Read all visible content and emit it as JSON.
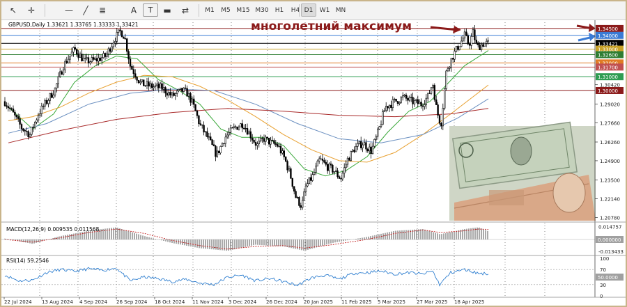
{
  "toolbar": {
    "tools": [
      {
        "name": "cursor-icon",
        "glyph": "↖"
      },
      {
        "name": "crosshair-icon",
        "glyph": "✛"
      },
      {
        "name": "horizontal-line-icon",
        "glyph": "—"
      },
      {
        "name": "trend-line-icon",
        "glyph": "╱"
      },
      {
        "name": "fibonacci-icon",
        "glyph": "≣"
      },
      {
        "name": "text-tool-icon",
        "glyph": "A"
      },
      {
        "name": "text-label-icon",
        "glyph": "T"
      },
      {
        "name": "rectangle-icon",
        "glyph": "▬"
      },
      {
        "name": "shapes-menu-icon",
        "glyph": "⇄"
      }
    ],
    "timeframes": [
      "M1",
      "M5",
      "M15",
      "M30",
      "H1",
      "H4",
      "D1",
      "W1",
      "MN"
    ],
    "active_timeframe": "D1"
  },
  "chart_data": {
    "type": "candlestick",
    "symbol_info": "GBPUSD,Daily  1.33621  1.33765  1.33333  1.33421",
    "annotation": "многолетний максимум",
    "ylim": [
      1.2045,
      1.3495
    ],
    "price_ticks": [
      "1.34500",
      "1.34000",
      "1.33421",
      "1.33000",
      "1.32600",
      "1.32000",
      "1.31700",
      "1.31000",
      "1.30420",
      "1.30000",
      "1.29020",
      "1.27660",
      "1.26260",
      "1.24900",
      "1.23500",
      "1.22140",
      "1.20780"
    ],
    "price_levels": [
      {
        "value": 1.345,
        "label": "1.34500",
        "color": "#8b1a1a"
      },
      {
        "value": 1.34,
        "label": "1.34000",
        "color": "#3a7bd5"
      },
      {
        "value": 1.33421,
        "label": "1.33421",
        "color": "#000000"
      },
      {
        "value": 1.33,
        "label": "1.33000",
        "color": "#c9a227"
      },
      {
        "value": 1.326,
        "label": "1.32600",
        "color": "#2e7d32"
      },
      {
        "value": 1.32,
        "label": "1.32000",
        "color": "#e07b24"
      },
      {
        "value": 1.317,
        "label": "1.31700",
        "color": "#c05050"
      },
      {
        "value": 1.31,
        "label": "1.31000",
        "color": "#2e9d52"
      },
      {
        "value": 1.3,
        "label": "1.30000",
        "color": "#8b1a1a"
      }
    ],
    "date_labels": [
      "22 Jul 2024",
      "13 Aug 2024",
      "4 Sep 2024",
      "26 Sep 2024",
      "18 Oct 2024",
      "11 Nov 2024",
      "3 Dec 2024",
      "26 Dec 2024",
      "20 Jan 2025",
      "11 Feb 2025",
      "5 Mar 2025",
      "27 Mar 2025",
      "18 Apr 2025"
    ],
    "anchors": [
      [
        0,
        1.292
      ],
      [
        12,
        1.283
      ],
      [
        24,
        1.273
      ],
      [
        36,
        1.268
      ],
      [
        48,
        1.283
      ],
      [
        60,
        1.292
      ],
      [
        72,
        1.301
      ],
      [
        84,
        1.318
      ],
      [
        100,
        1.33
      ],
      [
        115,
        1.321
      ],
      [
        130,
        1.322
      ],
      [
        145,
        1.325
      ],
      [
        158,
        1.338
      ],
      [
        166,
        1.343
      ],
      [
        172,
        1.339
      ],
      [
        180,
        1.318
      ],
      [
        195,
        1.305
      ],
      [
        210,
        1.303
      ],
      [
        225,
        1.302
      ],
      [
        240,
        1.296
      ],
      [
        255,
        1.3
      ],
      [
        262,
        1.298
      ],
      [
        270,
        1.29
      ],
      [
        280,
        1.275
      ],
      [
        292,
        1.265
      ],
      [
        304,
        1.253
      ],
      [
        316,
        1.266
      ],
      [
        330,
        1.273
      ],
      [
        342,
        1.276
      ],
      [
        352,
        1.268
      ],
      [
        362,
        1.26
      ],
      [
        372,
        1.265
      ],
      [
        382,
        1.262
      ],
      [
        392,
        1.26
      ],
      [
        402,
        1.25
      ],
      [
        410,
        1.238
      ],
      [
        418,
        1.222
      ],
      [
        426,
        1.216
      ],
      [
        432,
        1.23
      ],
      [
        442,
        1.238
      ],
      [
        452,
        1.25
      ],
      [
        462,
        1.245
      ],
      [
        472,
        1.242
      ],
      [
        482,
        1.236
      ],
      [
        492,
        1.25
      ],
      [
        502,
        1.258
      ],
      [
        514,
        1.262
      ],
      [
        526,
        1.256
      ],
      [
        536,
        1.27
      ],
      [
        546,
        1.288
      ],
      [
        560,
        1.292
      ],
      [
        572,
        1.295
      ],
      [
        584,
        1.292
      ],
      [
        598,
        1.29
      ],
      [
        608,
        1.296
      ],
      [
        614,
        1.306
      ],
      [
        620,
        1.285
      ],
      [
        626,
        1.275
      ],
      [
        634,
        1.315
      ],
      [
        644,
        1.326
      ],
      [
        652,
        1.333
      ],
      [
        660,
        1.34
      ],
      [
        666,
        1.333
      ],
      [
        672,
        1.342
      ],
      [
        678,
        1.331
      ],
      [
        686,
        1.334
      ],
      [
        694,
        1.3342
      ]
    ],
    "moving_averages": [
      {
        "color": "#3aa83a",
        "points": [
          [
            5,
            1.288
          ],
          [
            40,
            1.272
          ],
          [
            70,
            1.283
          ],
          [
            100,
            1.306
          ],
          [
            130,
            1.318
          ],
          [
            160,
            1.325
          ],
          [
            190,
            1.323
          ],
          [
            220,
            1.308
          ],
          [
            250,
            1.3
          ],
          [
            280,
            1.29
          ],
          [
            310,
            1.272
          ],
          [
            340,
            1.266
          ],
          [
            370,
            1.266
          ],
          [
            400,
            1.26
          ],
          [
            430,
            1.243
          ],
          [
            460,
            1.238
          ],
          [
            490,
            1.242
          ],
          [
            520,
            1.252
          ],
          [
            550,
            1.27
          ],
          [
            580,
            1.285
          ],
          [
            610,
            1.292
          ],
          [
            630,
            1.302
          ],
          [
            660,
            1.318
          ],
          [
            694,
            1.329
          ]
        ]
      },
      {
        "color": "#e8a030",
        "points": [
          [
            5,
            1.278
          ],
          [
            40,
            1.281
          ],
          [
            80,
            1.288
          ],
          [
            120,
            1.298
          ],
          [
            160,
            1.306
          ],
          [
            200,
            1.311
          ],
          [
            240,
            1.31
          ],
          [
            280,
            1.303
          ],
          [
            320,
            1.293
          ],
          [
            360,
            1.281
          ],
          [
            400,
            1.268
          ],
          [
            440,
            1.257
          ],
          [
            480,
            1.249
          ],
          [
            520,
            1.248
          ],
          [
            560,
            1.255
          ],
          [
            600,
            1.268
          ],
          [
            640,
            1.283
          ],
          [
            694,
            1.304
          ]
        ]
      },
      {
        "color": "#6a8fc0",
        "points": [
          [
            5,
            1.269
          ],
          [
            60,
            1.276
          ],
          [
            120,
            1.29
          ],
          [
            180,
            1.298
          ],
          [
            240,
            1.301
          ],
          [
            300,
            1.3
          ],
          [
            360,
            1.29
          ],
          [
            420,
            1.276
          ],
          [
            480,
            1.265
          ],
          [
            540,
            1.262
          ],
          [
            600,
            1.268
          ],
          [
            650,
            1.28
          ],
          [
            694,
            1.294
          ]
        ]
      },
      {
        "color": "#a82828",
        "points": [
          [
            5,
            1.262
          ],
          [
            80,
            1.271
          ],
          [
            160,
            1.279
          ],
          [
            240,
            1.284
          ],
          [
            320,
            1.287
          ],
          [
            400,
            1.285
          ],
          [
            480,
            1.282
          ],
          [
            560,
            1.281
          ],
          [
            640,
            1.283
          ],
          [
            694,
            1.287
          ]
        ]
      }
    ],
    "macd": {
      "label": "MACD(12,26,9) 0.009535 0.011568",
      "ticks": [
        "0.014757",
        "0.000000",
        "-0.013433"
      ],
      "range": [
        -0.016,
        0.016
      ],
      "anchors": [
        [
          0,
          0.001
        ],
        [
          40,
          -0.005
        ],
        [
          80,
          0.004
        ],
        [
          120,
          0.01
        ],
        [
          160,
          0.014
        ],
        [
          200,
          0.004
        ],
        [
          240,
          -0.004
        ],
        [
          280,
          -0.01
        ],
        [
          320,
          -0.013
        ],
        [
          360,
          -0.006
        ],
        [
          400,
          -0.008
        ],
        [
          430,
          -0.013
        ],
        [
          470,
          -0.004
        ],
        [
          520,
          0.003
        ],
        [
          560,
          0.01
        ],
        [
          600,
          0.012
        ],
        [
          625,
          0.006
        ],
        [
          660,
          0.012
        ],
        [
          680,
          0.014
        ],
        [
          694,
          0.0095
        ]
      ],
      "signal_anchors": [
        [
          0,
          0.0
        ],
        [
          40,
          -0.003
        ],
        [
          80,
          0.002
        ],
        [
          120,
          0.008
        ],
        [
          160,
          0.012
        ],
        [
          200,
          0.007
        ],
        [
          240,
          -0.001
        ],
        [
          280,
          -0.007
        ],
        [
          320,
          -0.011
        ],
        [
          360,
          -0.008
        ],
        [
          400,
          -0.007
        ],
        [
          430,
          -0.01
        ],
        [
          470,
          -0.006
        ],
        [
          520,
          0.0
        ],
        [
          560,
          0.007
        ],
        [
          600,
          0.011
        ],
        [
          625,
          0.008
        ],
        [
          660,
          0.01
        ],
        [
          680,
          0.012
        ],
        [
          694,
          0.0116
        ]
      ]
    },
    "rsi": {
      "label": "RSI(14) 59.2546",
      "ticks": [
        "100",
        "70",
        "30",
        "0"
      ],
      "level_ticks": [
        "50.0000"
      ],
      "anchors": [
        [
          0,
          55
        ],
        [
          20,
          40
        ],
        [
          40,
          42
        ],
        [
          60,
          62
        ],
        [
          80,
          70
        ],
        [
          100,
          65
        ],
        [
          120,
          72
        ],
        [
          140,
          68
        ],
        [
          160,
          74
        ],
        [
          180,
          40
        ],
        [
          200,
          50
        ],
        [
          220,
          46
        ],
        [
          240,
          38
        ],
        [
          260,
          44
        ],
        [
          280,
          34
        ],
        [
          300,
          30
        ],
        [
          320,
          50
        ],
        [
          340,
          55
        ],
        [
          360,
          40
        ],
        [
          380,
          46
        ],
        [
          400,
          38
        ],
        [
          420,
          28
        ],
        [
          440,
          48
        ],
        [
          460,
          55
        ],
        [
          480,
          44
        ],
        [
          500,
          60
        ],
        [
          520,
          62
        ],
        [
          540,
          66
        ],
        [
          560,
          58
        ],
        [
          580,
          62
        ],
        [
          600,
          58
        ],
        [
          614,
          66
        ],
        [
          624,
          30
        ],
        [
          640,
          62
        ],
        [
          660,
          70
        ],
        [
          680,
          60
        ],
        [
          694,
          59
        ]
      ]
    }
  }
}
